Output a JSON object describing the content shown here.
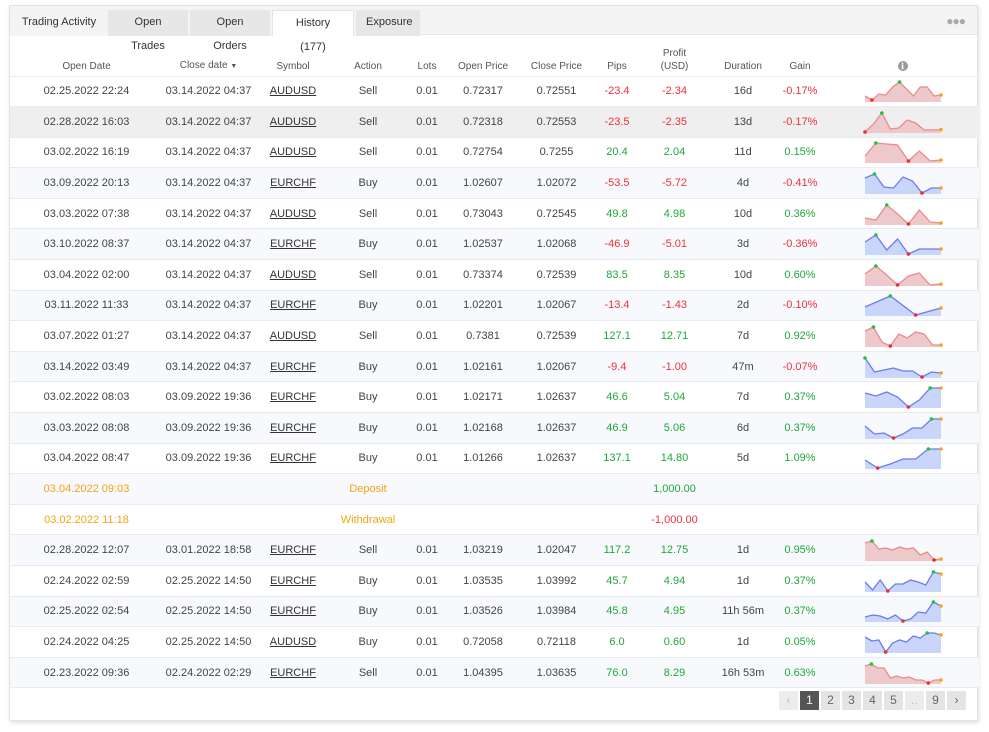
{
  "tabs": [
    {
      "label": "Trading Activity",
      "active": false
    },
    {
      "label": "Open Trades",
      "active": false
    },
    {
      "label": "Open Orders",
      "active": false
    },
    {
      "label": "History (177)",
      "active": true
    },
    {
      "label": "Exposure",
      "active": false
    }
  ],
  "more_icon": "ellipsis-icon",
  "columns": {
    "open_date": "Open Date",
    "close_date": "Close date",
    "close_date_sort": "▼",
    "symbol": "Symbol",
    "action": "Action",
    "lots": "Lots",
    "open_price": "Open Price",
    "close_price": "Close Price",
    "pips": "Pips",
    "profit_line1": "Profit",
    "profit_line2": "(USD)",
    "duration": "Duration",
    "gain": "Gain",
    "chart_info_icon": "i"
  },
  "rows": [
    {
      "type": "trade",
      "open": "02.25.2022 22:24",
      "close": "03.14.2022 04:37",
      "symbol": "AUDUSD",
      "action": "Sell",
      "lots": "0.01",
      "open_price": "0.72317",
      "close_price": "0.72551",
      "pips": "-23.4",
      "profit": "-2.34",
      "duration": "16d",
      "gain": "-0.17%",
      "sign": "neg",
      "spark": {
        "color": "red",
        "points": [
          0.25,
          0.05,
          0.35,
          0.3,
          0.7,
          0.95,
          0.6,
          0.25,
          0.7,
          0.7,
          0.25,
          0.3
        ],
        "max": 5,
        "min": 1
      }
    },
    {
      "type": "trade",
      "open": "02.28.2022 16:03",
      "close": "03.14.2022 04:37",
      "symbol": "AUDUSD",
      "action": "Sell",
      "lots": "0.01",
      "open_price": "0.72318",
      "close_price": "0.72553",
      "pips": "-23.5",
      "profit": "-2.35",
      "duration": "13d",
      "gain": "-0.17%",
      "sign": "neg",
      "spark": {
        "color": "red",
        "points": [
          0.0,
          0.4,
          0.95,
          0.15,
          0.2,
          0.6,
          0.45,
          0.1,
          0.1,
          0.12
        ],
        "max": 2,
        "min": 0
      },
      "hover": true
    },
    {
      "type": "trade",
      "open": "03.02.2022 16:19",
      "close": "03.14.2022 04:37",
      "symbol": "AUDUSD",
      "action": "Sell",
      "lots": "0.01",
      "open_price": "0.72754",
      "close_price": "0.7255",
      "pips": "20.4",
      "profit": "2.04",
      "duration": "11d",
      "gain": "0.15%",
      "sign": "pos",
      "spark": {
        "color": "red",
        "points": [
          0.3,
          0.95,
          0.9,
          0.85,
          0.05,
          0.55,
          0.05,
          0.1
        ],
        "max": 1,
        "min": 4
      }
    },
    {
      "type": "trade",
      "open": "03.09.2022 20:13",
      "close": "03.14.2022 04:37",
      "symbol": "EURCHF",
      "action": "Buy",
      "lots": "0.01",
      "open_price": "1.02607",
      "close_price": "1.02072",
      "pips": "-53.5",
      "profit": "-5.72",
      "duration": "4d",
      "gain": "-0.41%",
      "sign": "neg",
      "spark": {
        "color": "blue",
        "points": [
          0.75,
          0.95,
          0.3,
          0.25,
          0.8,
          0.6,
          0.0,
          0.25,
          0.25
        ],
        "max": 1,
        "min": 6
      }
    },
    {
      "type": "trade",
      "open": "03.03.2022 07:38",
      "close": "03.14.2022 04:37",
      "symbol": "AUDUSD",
      "action": "Sell",
      "lots": "0.01",
      "open_price": "0.73043",
      "close_price": "0.72545",
      "pips": "49.8",
      "profit": "4.98",
      "duration": "10d",
      "gain": "0.36%",
      "sign": "pos",
      "spark": {
        "color": "red",
        "points": [
          0.3,
          0.2,
          0.95,
          0.5,
          0.0,
          0.7,
          0.1,
          0.05
        ],
        "max": 2,
        "min": 4
      }
    },
    {
      "type": "trade",
      "open": "03.10.2022 08:37",
      "close": "03.14.2022 04:37",
      "symbol": "EURCHF",
      "action": "Buy",
      "lots": "0.01",
      "open_price": "1.02537",
      "close_price": "1.02068",
      "pips": "-46.9",
      "profit": "-5.01",
      "duration": "3d",
      "gain": "-0.36%",
      "sign": "neg",
      "spark": {
        "color": "blue",
        "points": [
          0.6,
          0.95,
          0.2,
          0.75,
          0.0,
          0.25,
          0.25,
          0.25
        ],
        "max": 1,
        "min": 4
      }
    },
    {
      "type": "trade",
      "open": "03.04.2022 02:00",
      "close": "03.14.2022 04:37",
      "symbol": "AUDUSD",
      "action": "Sell",
      "lots": "0.01",
      "open_price": "0.73374",
      "close_price": "0.72539",
      "pips": "83.5",
      "profit": "8.35",
      "duration": "10d",
      "gain": "0.60%",
      "sign": "pos",
      "spark": {
        "color": "red",
        "points": [
          0.55,
          0.95,
          0.5,
          0.0,
          0.45,
          0.6,
          0.0,
          0.05
        ],
        "max": 1,
        "min": 3
      }
    },
    {
      "type": "trade",
      "open": "03.11.2022 11:33",
      "close": "03.14.2022 04:37",
      "symbol": "EURCHF",
      "action": "Buy",
      "lots": "0.01",
      "open_price": "1.02201",
      "close_price": "1.02067",
      "pips": "-13.4",
      "profit": "-1.43",
      "duration": "2d",
      "gain": "-0.10%",
      "sign": "neg",
      "spark": {
        "color": "blue",
        "points": [
          0.4,
          0.95,
          0.0,
          0.35
        ],
        "max": 1,
        "min": 2
      }
    },
    {
      "type": "trade",
      "open": "03.07.2022 01:27",
      "close": "03.14.2022 04:37",
      "symbol": "AUDUSD",
      "action": "Sell",
      "lots": "0.01",
      "open_price": "0.7381",
      "close_price": "0.72539",
      "pips": "127.1",
      "profit": "12.71",
      "duration": "7d",
      "gain": "0.92%",
      "sign": "pos",
      "spark": {
        "color": "red",
        "points": [
          0.75,
          0.95,
          0.2,
          0.0,
          0.6,
          0.4,
          0.7,
          0.6,
          0.05,
          0.05
        ],
        "max": 1,
        "min": 3
      }
    },
    {
      "type": "trade",
      "open": "03.14.2022 03:49",
      "close": "03.14.2022 04:37",
      "symbol": "EURCHF",
      "action": "Buy",
      "lots": "0.01",
      "open_price": "1.02161",
      "close_price": "1.02067",
      "pips": "-9.4",
      "profit": "-1.00",
      "duration": "47m",
      "gain": "-0.07%",
      "sign": "neg",
      "spark": {
        "color": "blue",
        "points": [
          0.95,
          0.25,
          0.35,
          0.45,
          0.3,
          0.3,
          0.0,
          0.25,
          0.2
        ],
        "max": 0,
        "min": 6
      }
    },
    {
      "type": "trade",
      "open": "03.02.2022 08:03",
      "close": "03.09.2022 19:36",
      "symbol": "EURCHF",
      "action": "Buy",
      "lots": "0.01",
      "open_price": "1.02171",
      "close_price": "1.02637",
      "pips": "46.6",
      "profit": "5.04",
      "duration": "7d",
      "gain": "0.37%",
      "sign": "pos",
      "spark": {
        "color": "blue",
        "points": [
          0.7,
          0.55,
          0.75,
          0.5,
          0.0,
          0.35,
          0.95,
          0.95
        ],
        "max": 6,
        "min": 4
      }
    },
    {
      "type": "trade",
      "open": "03.03.2022 08:08",
      "close": "03.09.2022 19:36",
      "symbol": "EURCHF",
      "action": "Buy",
      "lots": "0.01",
      "open_price": "1.02168",
      "close_price": "1.02637",
      "pips": "46.9",
      "profit": "5.06",
      "duration": "6d",
      "gain": "0.37%",
      "sign": "pos",
      "spark": {
        "color": "blue",
        "points": [
          0.6,
          0.2,
          0.25,
          0.0,
          0.2,
          0.5,
          0.5,
          0.95,
          0.95
        ],
        "max": 7,
        "min": 3
      }
    },
    {
      "type": "trade",
      "open": "03.04.2022 08:47",
      "close": "03.09.2022 19:36",
      "symbol": "EURCHF",
      "action": "Buy",
      "lots": "0.01",
      "open_price": "1.01266",
      "close_price": "1.02637",
      "pips": "137.1",
      "profit": "14.80",
      "duration": "5d",
      "gain": "1.09%",
      "sign": "pos",
      "spark": {
        "color": "blue",
        "points": [
          0.4,
          0.0,
          0.2,
          0.45,
          0.45,
          0.95,
          0.95
        ],
        "max": 5,
        "min": 1
      }
    },
    {
      "type": "balance",
      "open": "03.04.2022 09:03",
      "label": "Deposit",
      "profit": "1,000.00",
      "sign": "pos"
    },
    {
      "type": "balance",
      "open": "03.02.2022 11:18",
      "label": "Withdrawal",
      "profit": "-1,000.00",
      "sign": "neg"
    },
    {
      "type": "trade",
      "open": "02.28.2022 12:07",
      "close": "03.01.2022 18:58",
      "symbol": "EURCHF",
      "action": "Sell",
      "lots": "0.01",
      "open_price": "1.03219",
      "close_price": "1.02047",
      "pips": "117.2",
      "profit": "12.75",
      "duration": "1d",
      "gain": "0.95%",
      "sign": "pos",
      "spark": {
        "color": "red",
        "points": [
          0.85,
          0.95,
          0.55,
          0.6,
          0.5,
          0.65,
          0.55,
          0.6,
          0.25,
          0.4,
          0.0,
          0.05
        ],
        "max": 1,
        "min": 10
      }
    },
    {
      "type": "trade",
      "open": "02.24.2022 02:59",
      "close": "02.25.2022 14:50",
      "symbol": "EURCHF",
      "action": "Buy",
      "lots": "0.01",
      "open_price": "1.03535",
      "close_price": "1.03992",
      "pips": "45.7",
      "profit": "4.94",
      "duration": "1d",
      "gain": "0.37%",
      "sign": "pos",
      "spark": {
        "color": "blue",
        "points": [
          0.45,
          0.05,
          0.55,
          0.0,
          0.35,
          0.35,
          0.55,
          0.45,
          0.3,
          0.95,
          0.85
        ],
        "max": 9,
        "min": 3
      }
    },
    {
      "type": "trade",
      "open": "02.25.2022 02:54",
      "close": "02.25.2022 14:50",
      "symbol": "EURCHF",
      "action": "Buy",
      "lots": "0.01",
      "open_price": "1.03526",
      "close_price": "1.03984",
      "pips": "45.8",
      "profit": "4.95",
      "duration": "11h 56m",
      "gain": "0.37%",
      "sign": "pos",
      "spark": {
        "color": "blue",
        "points": [
          0.2,
          0.3,
          0.25,
          0.1,
          0.3,
          0.0,
          0.1,
          0.45,
          0.4,
          0.95,
          0.75
        ],
        "max": 9,
        "min": 5
      }
    },
    {
      "type": "trade",
      "open": "02.24.2022 04:25",
      "close": "02.25.2022 14:50",
      "symbol": "AUDUSD",
      "action": "Buy",
      "lots": "0.01",
      "open_price": "0.72058",
      "close_price": "0.72118",
      "pips": "6.0",
      "profit": "0.60",
      "duration": "1d",
      "gain": "0.05%",
      "sign": "pos",
      "spark": {
        "color": "blue",
        "points": [
          0.75,
          0.55,
          0.6,
          0.0,
          0.45,
          0.6,
          0.5,
          0.8,
          0.7,
          0.95,
          0.95,
          0.85
        ],
        "max": 9,
        "min": 3
      }
    },
    {
      "type": "trade",
      "open": "02.23.2022 09:36",
      "close": "02.24.2022 02:29",
      "symbol": "EURCHF",
      "action": "Sell",
      "lots": "0.01",
      "open_price": "1.04395",
      "close_price": "1.03635",
      "pips": "76.0",
      "profit": "8.29",
      "duration": "16h 53m",
      "gain": "0.63%",
      "sign": "pos",
      "spark": {
        "color": "red",
        "points": [
          0.85,
          0.95,
          0.75,
          0.75,
          0.25,
          0.35,
          0.25,
          0.3,
          0.15,
          0.15,
          0.0,
          0.15,
          0.15
        ],
        "max": 1,
        "min": 10
      }
    }
  ],
  "pagination": {
    "prev": "‹",
    "pages": [
      "1",
      "2",
      "3",
      "4",
      "5",
      "..",
      "9"
    ],
    "current": "1",
    "next": "›"
  },
  "colors": {
    "positive": "#1fa83a",
    "negative": "#f0303a",
    "balance": "#f2a413",
    "spark_red_line": "#ec8a8c",
    "spark_red_fill": "#eec9cb",
    "spark_blue_line": "#6b7cef",
    "spark_blue_fill": "#c9d5fb",
    "spark_max": "#22c23a",
    "spark_min": "#f22a2a",
    "spark_last": "#f9a21c"
  }
}
